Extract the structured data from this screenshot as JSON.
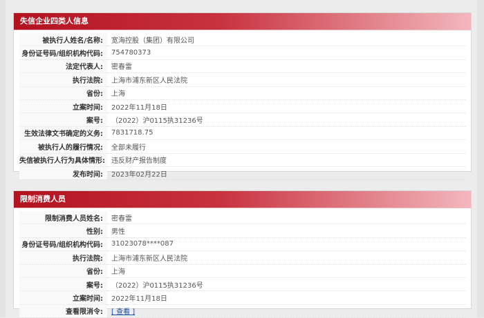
{
  "section1": {
    "title": "失信企业四类人信息",
    "rows": [
      {
        "label": "被执行人姓名/名称:",
        "value": "宽海控股（集团）有限公司"
      },
      {
        "label": "身份证号码/组织机构代码:",
        "value": "754780373"
      },
      {
        "label": "法定代表人:",
        "value": "密春雷"
      },
      {
        "label": "执行法院:",
        "value": "上海市浦东新区人民法院"
      },
      {
        "label": "省份:",
        "value": "上海"
      },
      {
        "label": "立案时间:",
        "value": "2022年11月18日"
      },
      {
        "label": "案号:",
        "value": "（2022）沪0115执31236号"
      },
      {
        "label": "生效法律文书确定的义务:",
        "value": "7831718.75"
      },
      {
        "label": "被执行人的履行情况:",
        "value": "全部未履行"
      },
      {
        "label": "失信被执行人行为具体情形:",
        "value": "违反财产报告制度"
      },
      {
        "label": "发布时间:",
        "value": "2023年02月22日"
      }
    ]
  },
  "section2": {
    "title": "限制消费人员",
    "rows": [
      {
        "label": "限制消费人员姓名:",
        "value": "密春雷"
      },
      {
        "label": "性别:",
        "value": "男性"
      },
      {
        "label": "身份证号码/组织机构代码:",
        "value": "31023078****087"
      },
      {
        "label": "执行法院:",
        "value": "上海市浦东新区人民法院"
      },
      {
        "label": "省份:",
        "value": "上海"
      },
      {
        "label": "案号:",
        "value": "（2022）沪0115执31236号"
      },
      {
        "label": "立案时间:",
        "value": "2022年11月18日"
      },
      {
        "label": "查看限消令:",
        "value": "[ 查看 ]"
      }
    ]
  }
}
